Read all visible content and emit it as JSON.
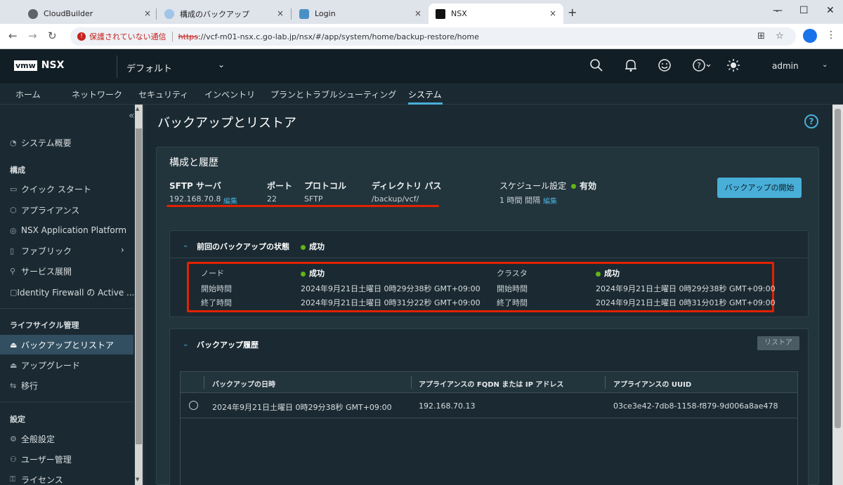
{
  "browser": {
    "tabs": [
      {
        "label": "CloudBuilder",
        "close": "×"
      },
      {
        "label": "構成のバックアップ",
        "close": "×"
      },
      {
        "label": "Login",
        "close": "×"
      },
      {
        "label": "NSX",
        "close": "×"
      }
    ],
    "new_tab": "+",
    "tablist": "⌄",
    "win": {
      "min": "—",
      "max": "☐",
      "close": "✕"
    },
    "nav": {
      "back": "←",
      "forward": "→",
      "reload": "↻"
    },
    "security_warning": "保護されていない通信",
    "url_scheme": "https",
    "url_rest": "://vcf-m01-nsx.c.go-lab.jp/nsx/#/app/system/home/backup-restore/home",
    "icons": {
      "translate": "⊞",
      "star": "☆",
      "kebab": "⋮"
    }
  },
  "header": {
    "logo_vmw": "vmw",
    "logo_text": "NSX",
    "project": "デフォルト",
    "project_caret": "⌄",
    "icons": {
      "search": "○",
      "bell": "△",
      "smiley": "☺",
      "help": "?",
      "theme": "☀"
    },
    "user": "admin",
    "user_caret": "⌄"
  },
  "nav": {
    "items": [
      "ホーム",
      "ネットワーク",
      "セキュリティ",
      "インベントリ",
      "プランとトラブルシューティング",
      "システム"
    ],
    "active": "システム"
  },
  "sidebar": {
    "collapse": "«",
    "overview": "システム概要",
    "section_config": "構成",
    "config_items": [
      "クイック スタート",
      "アプライアンス",
      "NSX Application Platform",
      "ファブリック",
      "サービス展開",
      "Identity Firewall の Active ..."
    ],
    "fabric_chevron": "›",
    "section_lifecycle": "ライフサイクル管理",
    "lifecycle_items": [
      "バックアップとリストア",
      "アップグレード",
      "移行"
    ],
    "section_settings": "設定",
    "settings_items": [
      "全般設定",
      "ユーザー管理",
      "ライセンス"
    ],
    "scroll_up": "▲",
    "scroll_down": "▼"
  },
  "page": {
    "title": "バックアップとリストア",
    "help": "?",
    "config": {
      "title": "構成と履歴",
      "sftp_label": "SFTP サーバ",
      "sftp_value": "192.168.70.8",
      "edit": "編集",
      "port_label": "ポート",
      "port_value": "22",
      "protocol_label": "プロトコル",
      "protocol_value": "SFTP",
      "dir_label": "ディレクトリ パス",
      "dir_value": "/backup/vcf/",
      "schedule_label": "スケジュール設定",
      "schedule_status": "有効",
      "schedule_value": "1 時間 間隔",
      "schedule_edit": "編集",
      "start_backup": "バックアップの開始"
    },
    "last_backup": {
      "caret": "⌄",
      "title": "前回のバックアップの状態",
      "status": "成功",
      "node_label": "ノード",
      "node_status": "成功",
      "node_start_label": "開始時間",
      "node_start": "2024年9月21日土曜日 0時29分38秒 GMT+09:00",
      "node_end_label": "終了時間",
      "node_end": "2024年9月21日土曜日 0時31分22秒 GMT+09:00",
      "cluster_label": "クラスタ",
      "cluster_status": "成功",
      "cluster_start_label": "開始時間",
      "cluster_start": "2024年9月21日土曜日 0時29分38秒 GMT+09:00",
      "cluster_end_label": "終了時間",
      "cluster_end": "2024年9月21日土曜日 0時31分01秒 GMT+09:00"
    },
    "history": {
      "caret": "⌄",
      "title": "バックアップ履歴",
      "restore": "リストア",
      "columns": [
        "バックアップの日時",
        "アプライアンスの FQDN または IP アドレス",
        "アプライアンスの UUID"
      ],
      "rows": [
        {
          "datetime": "2024年9月21日土曜日 0時29分38秒 GMT+09:00",
          "ip": "192.168.70.13",
          "uuid": "03ce3e42-7db8-1158-f879-9d006a8ae478"
        }
      ]
    }
  },
  "colors": {
    "accent": "#49afd9",
    "success": "#60b515",
    "highlight_red": "#e12200"
  }
}
